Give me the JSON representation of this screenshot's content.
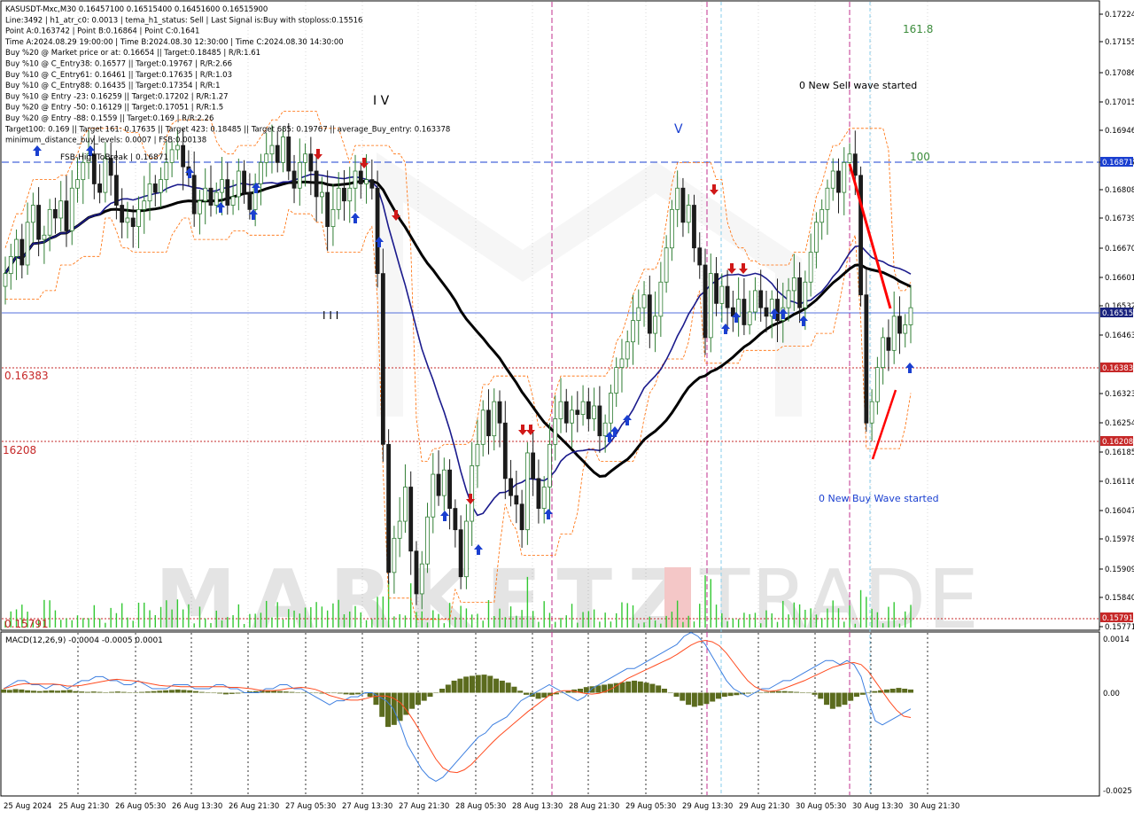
{
  "colors": {
    "background": "#ffffff",
    "grid": "#e6e6e6",
    "up_candle": "#2e7d32",
    "down_candle": "#1b1b1b",
    "ma_black": "#000000",
    "ma_navy": "#1a1a8c",
    "channel_orange": "#ff6a00",
    "magenta_line": "#c02f8e",
    "level_dashed": "#c62828",
    "blue_level": "#1a3fd0",
    "price_tag_blue": "#1a3fd0",
    "price_tag_red": "#c62828",
    "price_tag_navy": "#1a237e",
    "volume": "#32c832",
    "macd_hist": "#5b6b1e",
    "macd_line": "#3d7fe0",
    "signal_line": "#ff4b1f",
    "fib_text": "#3c8c3c",
    "arrow_up": "#1a3fd0",
    "arrow_down": "#d01818",
    "wave_red": "#ff0000",
    "watermark": "#b4b4b4",
    "watermark_red": "#e06060"
  },
  "info_lines": [
    "KASUSDT-Mxc,M30  0.16457100 0.16515400 0.16451600 0.16515900",
    "Line:3492 | h1_atr_c0: 0.0013 | tema_h1_status: Sell | Last Signal is:Buy with stoploss:0.15516",
    "Point A:0.163742 | Point B:0.16864 | Point C:0.1641",
    "Time A:2024.08.29 19:00:00 | Time B:2024.08.30 12:30:00 | Time C:2024.08.30 14:30:00",
    "Buy %20 @ Market price or at: 0.16654 || Target:0.18485 | R/R:1.61",
    "Buy %10 @ C_Entry38: 0.16577 || Target:0.19767 | R/R:2.66",
    "Buy %10 @ C_Entry61: 0.16461 || Target:0.17635 | R/R:1.03",
    "Buy %10 @ C_Entry88: 0.16435 || Target:0.17354 | R/R:1",
    "Buy %10 @ Entry -23: 0.16259 || Target:0.17202 | R/R:1.27",
    "Buy %20 @ Entry -50: 0.16129 || Target:0.17051 | R/R:1.5",
    "Buy %20 @ Entry -88: 0.1559 || Target:0.169 | R/R:2.26",
    "Target100: 0.169 || Target 161: 0.17635 || Target 423: 0.18485 || Target 685: 0.19767 || average_Buy_entry: 0.163378",
    "minimum_distance_buy_levels: 0.0007 | FSB:0.00138"
  ],
  "labels": {
    "fsb": "FSB-HighToBreak | 0.16871",
    "wave_sell": "0 New Sell wave started",
    "wave_buy": "0 New Buy Wave started",
    "fib_1618": "161.8",
    "fib_100": "100",
    "wave_IV": "I V",
    "wave_V": "V",
    "wave_III": "I I I",
    "level_16383": "0.16383",
    "level_16208": "16208",
    "level_15791": "0.15791",
    "macd_title": "MACD(12,26,9) -0.0004 -0.0005 0.0001",
    "watermark_left": "MARKETZ",
    "watermark_right": "TRADE"
  },
  "price_axis": [
    "0.17224",
    "0.17155",
    "0.17086",
    "0.17015",
    "0.16946",
    "0.16877",
    "0.16808",
    "0.16739",
    "0.16670",
    "0.16601",
    "0.16532",
    "0.16463",
    "0.16323",
    "0.16254",
    "0.16185",
    "0.16116",
    "0.16047",
    "0.15978",
    "0.15909",
    "0.15840",
    "0.15771"
  ],
  "price_tags": [
    {
      "text": "0.16871",
      "kind": "blue"
    },
    {
      "text": "0.16515",
      "kind": "navy"
    },
    {
      "text": "0.16383",
      "kind": "red"
    },
    {
      "text": "0.16208",
      "kind": "red"
    },
    {
      "text": "0.15791",
      "kind": "red"
    }
  ],
  "macd_axis": [
    "0.0014",
    "0.00",
    "-0.0025"
  ],
  "time_axis": [
    "25 Aug 2024",
    "25 Aug 21:30",
    "26 Aug 05:30",
    "26 Aug 13:30",
    "26 Aug 21:30",
    "27 Aug 05:30",
    "27 Aug 13:30",
    "27 Aug 21:30",
    "28 Aug 05:30",
    "28 Aug 13:30",
    "28 Aug 21:30",
    "29 Aug 05:30",
    "29 Aug 13:30",
    "29 Aug 21:30",
    "30 Aug 05:30",
    "30 Aug 13:30",
    "30 Aug 21:30"
  ],
  "chart_data": {
    "type": "candlestick",
    "symbol": "KASUSDT-Mxc",
    "timeframe": "M30",
    "ylim": [
      0.15771,
      0.17224
    ],
    "close_series": [
      0.166,
      0.1664,
      0.1668,
      0.1662,
      0.1672,
      0.1676,
      0.1668,
      0.1669,
      0.1675,
      0.1673,
      0.1677,
      0.167,
      0.168,
      0.1682,
      0.1686,
      0.1688,
      0.1681,
      0.1679,
      0.1687,
      0.1683,
      0.1676,
      0.1672,
      0.1673,
      0.1671,
      0.1675,
      0.1677,
      0.1681,
      0.1679,
      0.1682,
      0.1686,
      0.1689,
      0.169,
      0.1685,
      0.1683,
      0.1674,
      0.1677,
      0.168,
      0.1676,
      0.1679,
      0.1682,
      0.1676,
      0.1678,
      0.1684,
      0.1679,
      0.1675,
      0.1681,
      0.1686,
      0.1688,
      0.169,
      0.1686,
      0.1692,
      0.1684,
      0.168,
      0.1686,
      0.1688,
      0.1684,
      0.1678,
      0.1679,
      0.1671,
      0.1675,
      0.168,
      0.1677,
      0.168,
      0.1684,
      0.1681,
      0.1682,
      0.168,
      0.166,
      0.162,
      0.159,
      0.1598,
      0.1602,
      0.161,
      0.1595,
      0.1585,
      0.1592,
      0.1603,
      0.1613,
      0.1608,
      0.1614,
      0.1605,
      0.16,
      0.1589,
      0.1602,
      0.1615,
      0.162,
      0.1628,
      0.1622,
      0.163,
      0.1625,
      0.1612,
      0.1608,
      0.1606,
      0.16,
      0.1618,
      0.1612,
      0.1605,
      0.161,
      0.162,
      0.1626,
      0.163,
      0.1625,
      0.1628,
      0.1627,
      0.163,
      0.1626,
      0.1629,
      0.1622,
      0.1625,
      0.1632,
      0.1638,
      0.164,
      0.1644,
      0.1649,
      0.1652,
      0.1655,
      0.1646,
      0.165,
      0.1658,
      0.1666,
      0.1675,
      0.168,
      0.1672,
      0.1676,
      0.1666,
      0.1662,
      0.1645,
      0.166,
      0.1653,
      0.1657,
      0.1652,
      0.165,
      0.1654,
      0.1648,
      0.1651,
      0.1656,
      0.1652,
      0.165,
      0.1654,
      0.1649,
      0.1652,
      0.1656,
      0.1659,
      0.1652,
      0.1658,
      0.1665,
      0.1672,
      0.1675,
      0.168,
      0.1684,
      0.1679,
      0.1686,
      0.1688,
      0.1683,
      0.1655,
      0.1625,
      0.163,
      0.1638,
      0.1645,
      0.1642,
      0.165,
      0.1646,
      0.1648,
      0.1652
    ]
  },
  "macd_data": {
    "hist": [
      8e-05,
      7e-05,
      9e-05,
      8e-05,
      6e-05,
      5e-05,
      4e-05,
      5e-05,
      6e-05,
      5e-05,
      6e-05,
      7e-05,
      4e-05,
      3e-05,
      2e-05,
      3e-05,
      2e-05,
      1e-05,
      2e-05,
      3e-05,
      2e-05,
      1e-05,
      1e-05,
      2e-05,
      3e-05,
      4e-05,
      5e-05,
      6e-05,
      7e-05,
      8e-05,
      7e-05,
      6e-05,
      4e-05,
      2e-05,
      1e-05,
      0.0,
      -2e-05,
      -4e-05,
      -3e-05,
      -2e-05,
      0.0,
      3e-05,
      4e-05,
      5e-05,
      6e-05,
      5e-05,
      4e-05,
      3e-05,
      2e-05,
      1e-05,
      0.0,
      0.0,
      -1e-05,
      -2e-05,
      -1e-05,
      0.0,
      -2e-05,
      -4e-05,
      -5e-05,
      -4e-05,
      -2e-05,
      -0.0001,
      -0.0003,
      -0.0006,
      -0.00085,
      -0.0008,
      -0.0007,
      -0.00055,
      -0.0004,
      -0.0003,
      -0.0002,
      -0.0001,
      0.0,
      0.0001,
      0.0002,
      0.0003,
      0.00035,
      0.0004,
      0.00042,
      0.00044,
      0.00045,
      0.00042,
      0.00035,
      0.0003,
      0.00025,
      0.00015,
      5e-05,
      -5e-05,
      -0.0001,
      -0.00015,
      -0.00012,
      -8e-05,
      -4e-05,
      0.0,
      4e-05,
      8e-05,
      0.0001,
      0.00014,
      0.00016,
      0.00018,
      0.0002,
      0.00022,
      0.00024,
      0.00026,
      0.00028,
      0.0003,
      0.00028,
      0.00025,
      0.00022,
      0.00018,
      0.0001,
      0.0,
      -0.0001,
      -0.0002,
      -0.0003,
      -0.00035,
      -0.00032,
      -0.00028,
      -0.00022,
      -0.00015,
      -0.0001,
      -8e-05,
      -6e-05,
      -4e-05,
      -2e-05,
      -1e-05,
      0.0,
      2e-05,
      3e-05,
      4e-05,
      4e-05,
      3e-05,
      2e-05,
      1e-05,
      0.0,
      -5e-05,
      -0.00015,
      -0.0003,
      -0.0004,
      -0.00035,
      -0.0003,
      -0.0002,
      -0.0001,
      -5e-05,
      0.0,
      4e-05,
      6e-05,
      8e-05,
      0.0001,
      0.00012,
      0.0001,
      8e-05
    ],
    "macd_line": [
      0.0001,
      0.0002,
      0.0003,
      0.0003,
      0.0002,
      0.0002,
      0.0001,
      0.0002,
      0.0002,
      0.0001,
      0.0002,
      0.0003,
      0.0003,
      0.0004,
      0.0004,
      0.0003,
      0.0003,
      0.0002,
      0.0002,
      0.0003,
      0.0002,
      0.0001,
      0.0001,
      0.0001,
      0.0002,
      0.0002,
      0.0002,
      0.0001,
      0.0001,
      0.0001,
      0.0002,
      0.0002,
      0.0001,
      0.0001,
      0.0,
      0.0,
      0.0,
      0.0001,
      0.0001,
      0.0002,
      0.0002,
      0.0001,
      0.0001,
      0.0,
      -0.0001,
      -0.0002,
      -0.0003,
      -0.0002,
      -0.0002,
      -0.0001,
      -0.0001,
      0.0,
      0.0,
      -0.0001,
      -0.0002,
      -0.0004,
      -0.0008,
      -0.0013,
      -0.0016,
      -0.0019,
      -0.0021,
      -0.0022,
      -0.0021,
      -0.0019,
      -0.0017,
      -0.0015,
      -0.0013,
      -0.0011,
      -0.001,
      -0.0008,
      -0.0007,
      -0.0006,
      -0.0004,
      -0.0002,
      -0.0001,
      0.0,
      0.0001,
      0.0002,
      0.0001,
      0.0,
      -0.0001,
      -0.0002,
      -0.0001,
      0.0001,
      0.0002,
      0.0003,
      0.0004,
      0.0005,
      0.0006,
      0.0006,
      0.0007,
      0.0008,
      0.0009,
      0.001,
      0.0011,
      0.0012,
      0.0014,
      0.0015,
      0.0014,
      0.0012,
      0.0009,
      0.0006,
      0.0003,
      0.0001,
      0.0,
      -0.0001,
      0.0,
      0.0001,
      0.0001,
      0.0002,
      0.0003,
      0.0003,
      0.0004,
      0.0005,
      0.0006,
      0.0007,
      0.0008,
      0.0008,
      0.0007,
      0.0008,
      0.0007,
      0.0004,
      -0.0002,
      -0.0007,
      -0.0008,
      -0.0007,
      -0.0006,
      -0.0005,
      -0.0004
    ]
  }
}
